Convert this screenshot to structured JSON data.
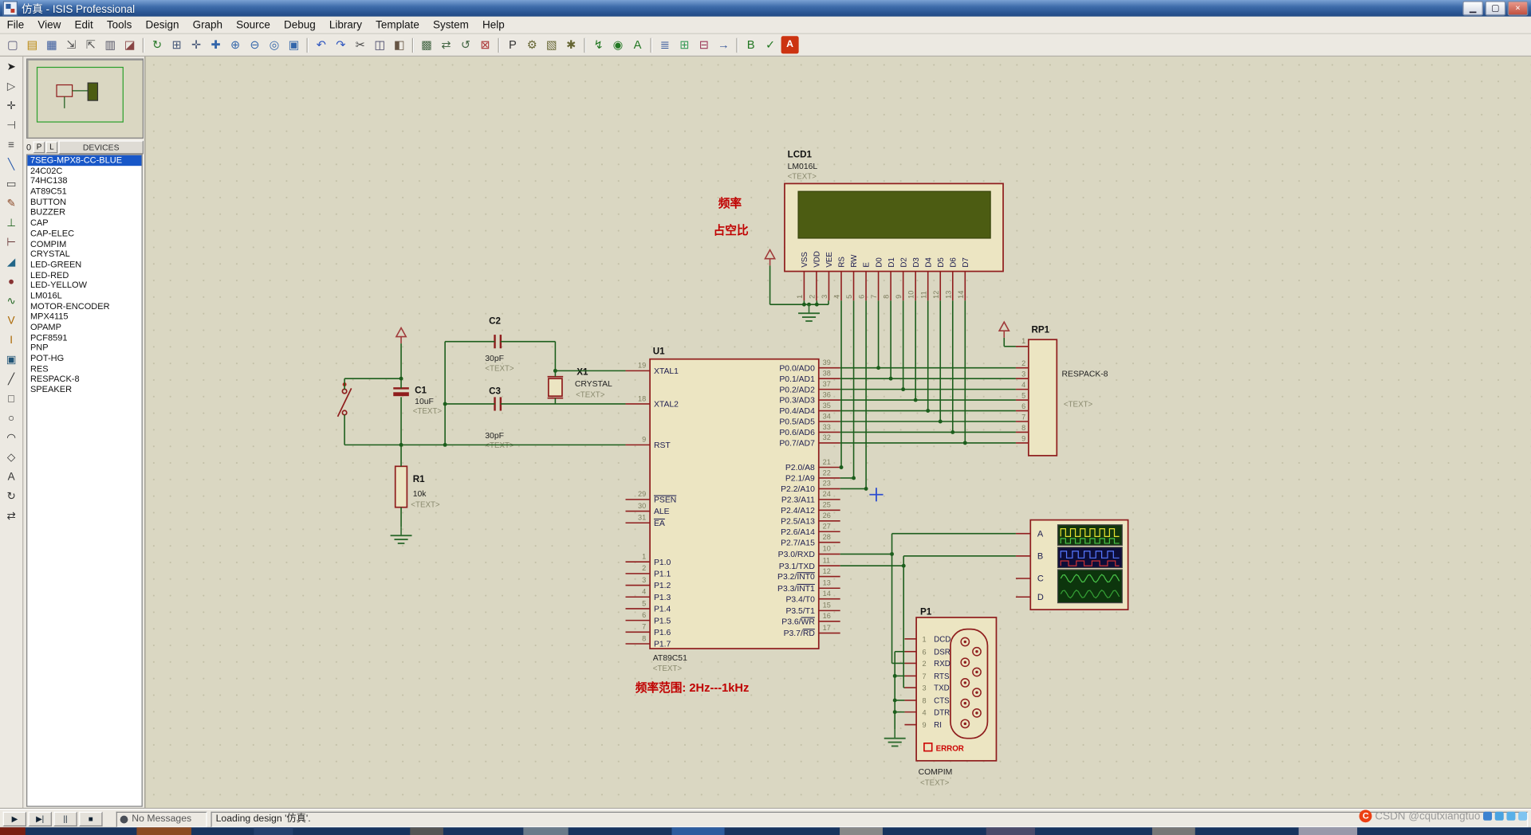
{
  "window": {
    "title": "仿真 - ISIS Professional",
    "controls": [
      {
        "name": "minimize",
        "glyph": "▁"
      },
      {
        "name": "maximize",
        "glyph": "▢"
      },
      {
        "name": "close",
        "glyph": "×"
      }
    ]
  },
  "menu_bar": {
    "items": [
      "File",
      "View",
      "Edit",
      "Tools",
      "Design",
      "Graph",
      "Source",
      "Debug",
      "Library",
      "Template",
      "System",
      "Help"
    ]
  },
  "toolbar": {
    "groups": [
      [
        {
          "name": "new-design",
          "glyph": "▢",
          "color": "#555577"
        },
        {
          "name": "open-design",
          "glyph": "▤",
          "color": "#b8860b"
        },
        {
          "name": "save-design",
          "glyph": "▦",
          "color": "#34569b"
        },
        {
          "name": "import-section",
          "glyph": "⇲",
          "color": "#555555"
        },
        {
          "name": "export-section",
          "glyph": "⇱",
          "color": "#555555"
        },
        {
          "name": "print",
          "glyph": "▥",
          "color": "#555566"
        },
        {
          "name": "mark-output-area",
          "glyph": "◪",
          "color": "#884444"
        }
      ],
      [
        {
          "name": "redraw",
          "glyph": "↻",
          "color": "#2a7a2a"
        },
        {
          "name": "toggle-grid",
          "glyph": "⊞",
          "color": "#445577"
        },
        {
          "name": "false-origin",
          "glyph": "✛",
          "color": "#445577"
        },
        {
          "name": "pan",
          "glyph": "✚",
          "color": "#3366aa"
        },
        {
          "name": "zoom-in",
          "glyph": "⊕",
          "color": "#3366aa"
        },
        {
          "name": "zoom-out",
          "glyph": "⊖",
          "color": "#3366aa"
        },
        {
          "name": "zoom-all",
          "glyph": "◎",
          "color": "#3366aa"
        },
        {
          "name": "zoom-area",
          "glyph": "▣",
          "color": "#3366aa"
        }
      ],
      [
        {
          "name": "undo",
          "glyph": "↶",
          "color": "#2a52be"
        },
        {
          "name": "redo",
          "glyph": "↷",
          "color": "#2a52be"
        },
        {
          "name": "cut",
          "glyph": "✂",
          "color": "#444444"
        },
        {
          "name": "copy",
          "glyph": "◫",
          "color": "#444466"
        },
        {
          "name": "paste",
          "glyph": "◧",
          "color": "#665544"
        }
      ],
      [
        {
          "name": "block-copy",
          "glyph": "▩",
          "color": "#446644"
        },
        {
          "name": "block-move",
          "glyph": "⇄",
          "color": "#446644"
        },
        {
          "name": "block-rotate",
          "glyph": "↺",
          "color": "#446644"
        },
        {
          "name": "block-delete",
          "glyph": "⊠",
          "color": "#aa3333"
        }
      ],
      [
        {
          "name": "pick-parts",
          "glyph": "P",
          "color": "#333333"
        },
        {
          "name": "make-device",
          "glyph": "⚙",
          "color": "#666633"
        },
        {
          "name": "packaging-tool",
          "glyph": "▧",
          "color": "#666633"
        },
        {
          "name": "decompose",
          "glyph": "✱",
          "color": "#666633"
        }
      ],
      [
        {
          "name": "wire-autorouter",
          "glyph": "↯",
          "color": "#227722"
        },
        {
          "name": "search-and-tag",
          "glyph": "◉",
          "color": "#227722"
        },
        {
          "name": "property-assignment",
          "glyph": "A",
          "color": "#227722"
        }
      ],
      [
        {
          "name": "design-explorer",
          "glyph": "≣",
          "color": "#335599"
        },
        {
          "name": "new-sheet",
          "glyph": "⊞",
          "color": "#339955"
        },
        {
          "name": "remove-sheet",
          "glyph": "⊟",
          "color": "#993355"
        },
        {
          "name": "goto-sheet",
          "glyph": "→",
          "color": "#335599"
        }
      ],
      [
        {
          "name": "bill-of-materials",
          "glyph": "B",
          "color": "#227722"
        },
        {
          "name": "electrical-rule-check",
          "glyph": "✓",
          "color": "#227722"
        },
        {
          "name": "netlist-to-ares",
          "glyph": "A",
          "color": "#ffffff",
          "bg": "#cc3311"
        }
      ]
    ]
  },
  "mode_toolbar": {
    "icons": [
      {
        "name": "selection-mode",
        "glyph": "➤",
        "color": "#222222"
      },
      {
        "name": "component-mode",
        "glyph": "▷",
        "color": "#444444"
      },
      {
        "name": "junction-dot-mode",
        "glyph": "✛",
        "color": "#444444"
      },
      {
        "name": "wire-label-mode",
        "glyph": "⊣",
        "color": "#444444"
      },
      {
        "name": "text-script-mode",
        "glyph": "≡",
        "color": "#444444"
      },
      {
        "name": "bus-mode",
        "glyph": "╲",
        "color": "#2255aa"
      },
      {
        "name": "subcircuit-mode",
        "glyph": "▭",
        "color": "#444444"
      },
      {
        "name": "instant-edit-mode",
        "glyph": "✎",
        "color": "#884422"
      },
      {
        "name": "terminal-mode",
        "glyph": "⊥",
        "color": "#226622"
      },
      {
        "name": "device-pin-mode",
        "glyph": "⊢",
        "color": "#663333"
      },
      {
        "name": "graph-mode",
        "glyph": "◢",
        "color": "#226688"
      },
      {
        "name": "tape-recorder-mode",
        "glyph": "●",
        "color": "#883333"
      },
      {
        "name": "generator-mode",
        "glyph": "∿",
        "color": "#226622"
      },
      {
        "name": "voltage-probe-mode",
        "glyph": "V",
        "color": "#aa6600"
      },
      {
        "name": "current-probe-mode",
        "glyph": "I",
        "color": "#aa6600"
      },
      {
        "name": "virtual-instruments-mode",
        "glyph": "▣",
        "color": "#225577"
      },
      {
        "name": "2d-line-mode",
        "glyph": "╱",
        "color": "#333333"
      },
      {
        "name": "2d-box-mode",
        "glyph": "□",
        "color": "#333333"
      },
      {
        "name": "2d-circle-mode",
        "glyph": "○",
        "color": "#333333"
      },
      {
        "name": "2d-arc-mode",
        "glyph": "◠",
        "color": "#333333"
      },
      {
        "name": "2d-path-mode",
        "glyph": "◇",
        "color": "#333333"
      },
      {
        "name": "2d-text-mode",
        "glyph": "A",
        "color": "#333333"
      },
      {
        "name": "rotate-clockwise",
        "glyph": "↻",
        "color": "#333333"
      },
      {
        "name": "mirror-horizontal",
        "glyph": "⇄",
        "color": "#333333"
      }
    ]
  },
  "left_panel": {
    "rotation_value": "0",
    "pick_button": "P",
    "library_button": "L",
    "devices_header": "DEVICES",
    "selected_device": "7SEG-MPX8-CC-BLUE",
    "devices": [
      "7SEG-MPX8-CC-BLUE",
      "24C02C",
      "74HC138",
      "AT89C51",
      "BUTTON",
      "BUZZER",
      "CAP",
      "CAP-ELEC",
      "COMPIM",
      "CRYSTAL",
      "LED-GREEN",
      "LED-RED",
      "LED-YELLOW",
      "LM016L",
      "MOTOR-ENCODER",
      "MPX4115",
      "OPAMP",
      "PCF8591",
      "PNP",
      "POT-HG",
      "RES",
      "RESPACK-8",
      "SPEAKER"
    ]
  },
  "sim_controls": [
    {
      "name": "play",
      "glyph": "▶"
    },
    {
      "name": "step",
      "glyph": "▶|"
    },
    {
      "name": "pause",
      "glyph": "||"
    },
    {
      "name": "stop",
      "glyph": "■"
    }
  ],
  "status_bar": {
    "no_messages": "No Messages",
    "status": "Loading design '仿真'."
  },
  "watermark": {
    "logo": "C",
    "text": "CSDN @cqutxiangtuo"
  },
  "schematic": {
    "colors": {
      "wire": "#1c5e1c",
      "component": "#8f1d1d",
      "fill": "#ece5c2",
      "pin_number": "#7d7d5e",
      "pin_name": "#1d1d50",
      "annotation": "#c00000",
      "power": "#a03a3a",
      "ground": "#2f6b2f",
      "lcd_screen": "#4c5c12"
    },
    "annotations": {
      "freq": "频率",
      "duty": "占空比",
      "range": "频率范围: 2Hz---1kHz"
    },
    "lcd": {
      "ref": "LCD1",
      "part": "LM016L",
      "text": "<TEXT>",
      "pins": [
        {
          "num": "1",
          "name": "VSS"
        },
        {
          "num": "2",
          "name": "VDD"
        },
        {
          "num": "3",
          "name": "VEE"
        },
        {
          "num": "4",
          "name": "RS"
        },
        {
          "num": "5",
          "name": "RW"
        },
        {
          "num": "6",
          "name": "E"
        },
        {
          "num": "7",
          "name": "D0"
        },
        {
          "num": "8",
          "name": "D1"
        },
        {
          "num": "9",
          "name": "D2"
        },
        {
          "num": "10",
          "name": "D3"
        },
        {
          "num": "11",
          "name": "D4"
        },
        {
          "num": "12",
          "name": "D5"
        },
        {
          "num": "13",
          "name": "D6"
        },
        {
          "num": "14",
          "name": "D7"
        }
      ]
    },
    "mcu": {
      "ref": "U1",
      "part": "AT89C51",
      "text": "<TEXT>",
      "left_pins": [
        {
          "num": "19",
          "name": "XTAL1"
        },
        {
          "num": "18",
          "name": "XTAL2"
        },
        {
          "num": "9",
          "name": "RST"
        },
        {
          "num": "29",
          "bar": "PSEN"
        },
        {
          "num": "30",
          "name": "ALE"
        },
        {
          "num": "31",
          "bar": "EA"
        },
        {
          "num": "1",
          "name": "P1.0"
        },
        {
          "num": "2",
          "name": "P1.1"
        },
        {
          "num": "3",
          "name": "P1.2"
        },
        {
          "num": "4",
          "name": "P1.3"
        },
        {
          "num": "5",
          "name": "P1.4"
        },
        {
          "num": "6",
          "name": "P1.5"
        },
        {
          "num": "7",
          "name": "P1.6"
        },
        {
          "num": "8",
          "name": "P1.7"
        }
      ],
      "right_pins": [
        {
          "num": "39",
          "name": "P0.0/AD0"
        },
        {
          "num": "38",
          "name": "P0.1/AD1"
        },
        {
          "num": "37",
          "name": "P0.2/AD2"
        },
        {
          "num": "36",
          "name": "P0.3/AD3"
        },
        {
          "num": "35",
          "name": "P0.4/AD4"
        },
        {
          "num": "34",
          "name": "P0.5/AD5"
        },
        {
          "num": "33",
          "name": "P0.6/AD6"
        },
        {
          "num": "32",
          "name": "P0.7/AD7"
        },
        {
          "num": "21",
          "name": "P2.0/A8"
        },
        {
          "num": "22",
          "name": "P2.1/A9"
        },
        {
          "num": "23",
          "name": "P2.2/A10"
        },
        {
          "num": "24",
          "name": "P2.3/A11"
        },
        {
          "num": "25",
          "name": "P2.4/A12"
        },
        {
          "num": "26",
          "name": "P2.5/A13"
        },
        {
          "num": "27",
          "name": "P2.6/A14"
        },
        {
          "num": "28",
          "name": "P2.7/A15"
        },
        {
          "num": "10",
          "name": "P3.0/RXD"
        },
        {
          "num": "11",
          "name": "P3.1/TXD"
        },
        {
          "num": "12",
          "name": "P3.2/",
          "bar": "INT0"
        },
        {
          "num": "13",
          "name": "P3.3/",
          "bar": "INT1"
        },
        {
          "num": "14",
          "name": "P3.4/T0"
        },
        {
          "num": "15",
          "name": "P3.5/T1"
        },
        {
          "num": "16",
          "name": "P3.6/",
          "bar": "WR"
        },
        {
          "num": "17",
          "name": "P3.7/",
          "bar": "RD"
        }
      ]
    },
    "crystal": {
      "ref": "X1",
      "part": "CRYSTAL",
      "text": "<TEXT>"
    },
    "caps": [
      {
        "ref": "C1",
        "value": "10uF",
        "text": "<TEXT>"
      },
      {
        "ref": "C2",
        "value": "30pF",
        "text": "<TEXT>"
      },
      {
        "ref": "C3",
        "value": "30pF",
        "text": "<TEXT>"
      }
    ],
    "resistor": {
      "ref": "R1",
      "value": "10k",
      "text": "<TEXT>"
    },
    "respack": {
      "ref": "RP1",
      "part": "RESPACK-8",
      "text": "<TEXT>",
      "pins": [
        "1",
        "2",
        "3",
        "4",
        "5",
        "6",
        "7",
        "8",
        "9"
      ]
    },
    "scope": {
      "channels": [
        "A",
        "B",
        "C",
        "D"
      ]
    },
    "compim": {
      "ref": "P1",
      "part": "COMPIM",
      "text": "<TEXT>",
      "error_label": "ERROR",
      "pins": [
        {
          "num": "1",
          "name": "DCD"
        },
        {
          "num": "6",
          "name": "DSR"
        },
        {
          "num": "2",
          "name": "RXD"
        },
        {
          "num": "7",
          "name": "RTS"
        },
        {
          "num": "3",
          "name": "TXD"
        },
        {
          "num": "8",
          "name": "CTS"
        },
        {
          "num": "4",
          "name": "DTR"
        },
        {
          "num": "9",
          "name": "RI"
        }
      ]
    }
  }
}
